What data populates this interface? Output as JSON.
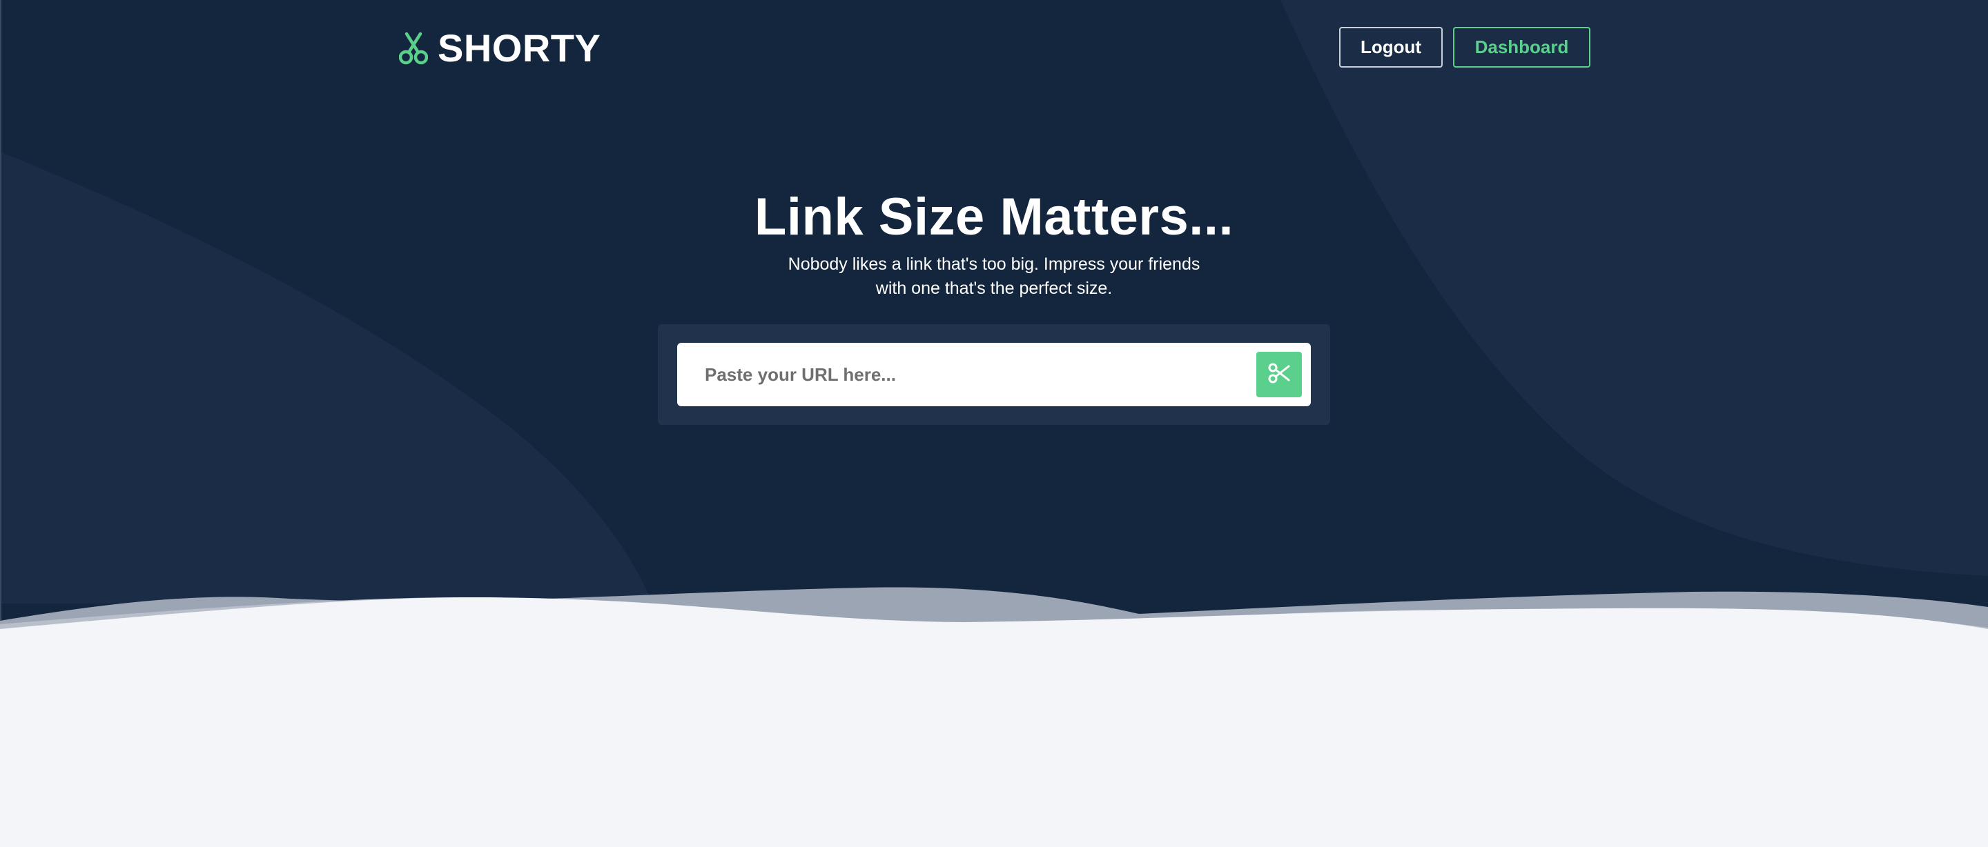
{
  "header": {
    "brand": "SHORTY",
    "logo_icon": "scissors-icon",
    "nav": {
      "logout_label": "Logout",
      "dashboard_label": "Dashboard"
    }
  },
  "hero": {
    "title": "Link Size Matters...",
    "subtitle_line1": "Nobody likes a link that's too big. Impress your friends",
    "subtitle_line2": "with one that's the perfect size."
  },
  "shortener": {
    "placeholder": "Paste your URL here...",
    "value": "",
    "button_icon": "scissors-icon"
  },
  "colors": {
    "hero_background": "#14263d",
    "hero_shape": "#1b2d46",
    "accent": "#5bd08c",
    "form_panel": "#21324c",
    "page_background": "#f4f5f9",
    "wave": "#9ca5b3"
  }
}
